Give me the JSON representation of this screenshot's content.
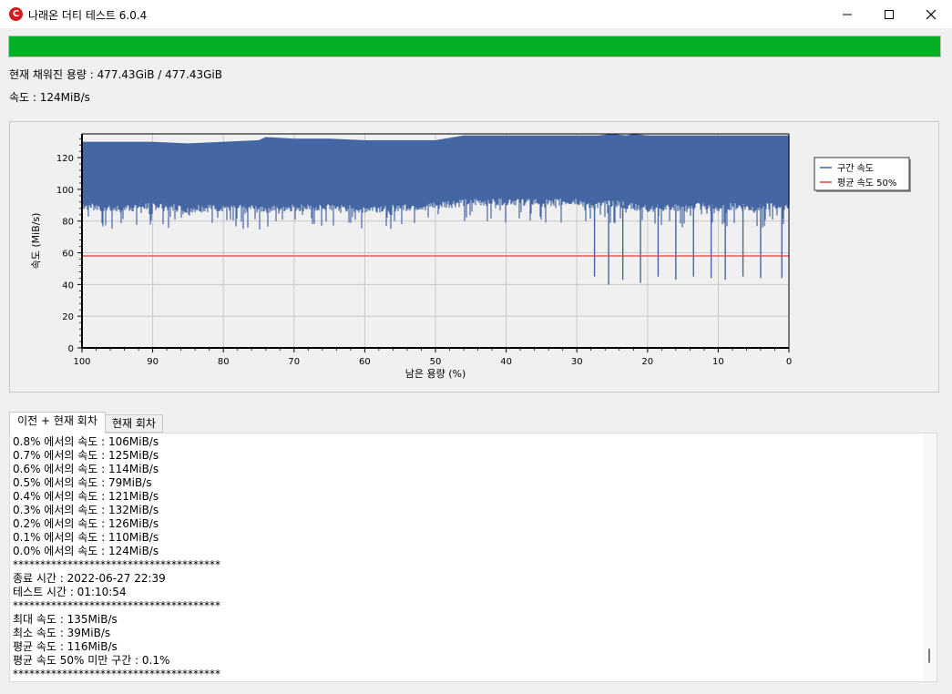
{
  "window": {
    "title": "나래온 더티 테스트 6.0.4",
    "app_icon_letter": "C",
    "minimize_icon": "minimize-icon",
    "maximize_icon": "maximize-icon",
    "close_icon": "close-icon"
  },
  "progress": {
    "fraction": 1.0,
    "color": "#06b025"
  },
  "status": {
    "capacity_text": "현재 채워진 용량 : 477.43GiB / 477.43GiB",
    "speed_text": "속도 : 124MiB/s"
  },
  "chart_data": {
    "type": "area",
    "xlabel": "남은 용량 (%)",
    "ylabel": "속도 (MiB/s)",
    "xlim": [
      100,
      0
    ],
    "ylim": [
      0,
      135
    ],
    "x_ticks": [
      "100",
      "90",
      "80",
      "70",
      "60",
      "50",
      "40",
      "30",
      "20",
      "10",
      "0"
    ],
    "y_ticks": [
      "0",
      "20",
      "40",
      "60",
      "80",
      "100",
      "120"
    ],
    "grid": true,
    "legend_position": "right",
    "series": [
      {
        "name": "구간 속도",
        "color": "#4466a2",
        "x": [
          100,
          95,
          90,
          85,
          80,
          75,
          74,
          70,
          65,
          60,
          55,
          50,
          46,
          45,
          40,
          35,
          30,
          28,
          27,
          25,
          23,
          22,
          20,
          18,
          15,
          13,
          10,
          8,
          5,
          3,
          0
        ],
        "y_max": [
          130,
          130,
          130,
          129,
          130,
          131,
          133,
          132,
          132,
          131,
          131,
          131,
          134,
          134,
          134,
          134,
          134,
          134,
          134,
          135,
          134,
          135,
          134,
          134,
          134,
          134,
          134,
          134,
          134,
          134,
          134
        ],
        "y_typical_min": [
          88,
          86,
          88,
          86,
          87,
          86,
          86,
          87,
          87,
          86,
          87,
          88,
          90,
          90,
          91,
          90,
          91,
          88,
          88,
          90,
          88,
          88,
          86,
          88,
          86,
          88,
          86,
          88,
          86,
          88,
          88
        ],
        "dips": [
          {
            "x": 27.5,
            "y": 45
          },
          {
            "x": 25.5,
            "y": 40
          },
          {
            "x": 23.5,
            "y": 43
          },
          {
            "x": 21.0,
            "y": 41
          },
          {
            "x": 18.5,
            "y": 45
          },
          {
            "x": 16.0,
            "y": 43
          },
          {
            "x": 13.5,
            "y": 45
          },
          {
            "x": 11.0,
            "y": 44
          },
          {
            "x": 9.0,
            "y": 43
          },
          {
            "x": 6.5,
            "y": 45
          },
          {
            "x": 4.0,
            "y": 44
          },
          {
            "x": 1.0,
            "y": 44
          }
        ]
      },
      {
        "name": "평균 속도 50%",
        "color": "#e23c3c",
        "x": [
          100,
          0
        ],
        "y": [
          58,
          58
        ]
      }
    ]
  },
  "tabs": [
    {
      "label": "이전 + 현재 회차",
      "active": true
    },
    {
      "label": "현재 회차",
      "active": false
    }
  ],
  "log_lines": [
    "0.8% 에서의 속도 : 106MiB/s",
    "0.7% 에서의 속도 : 125MiB/s",
    "0.6% 에서의 속도 : 114MiB/s",
    "0.5% 에서의 속도 : 79MiB/s",
    "0.4% 에서의 속도 : 121MiB/s",
    "0.3% 에서의 속도 : 132MiB/s",
    "0.2% 에서의 속도 : 126MiB/s",
    "0.1% 에서의 속도 : 110MiB/s",
    "0.0% 에서의 속도 : 124MiB/s",
    "**************************************",
    "종료 시간 : 2022-06-27 22:39",
    "테스트 시간 : 01:10:54",
    "**************************************",
    "최대 속도 : 135MiB/s",
    "최소 속도 : 39MiB/s",
    "평균 속도 : 116MiB/s",
    "평균 속도 50% 미만 구간 : 0.1%",
    "**************************************"
  ],
  "scroll_position": 0.97
}
